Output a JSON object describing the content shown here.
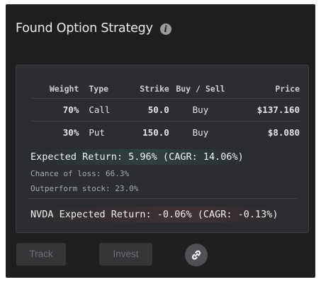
{
  "header": {
    "title": "Found Option Strategy",
    "info_icon": "info-icon"
  },
  "table": {
    "columns": [
      "Weight",
      "Type",
      "Strike",
      "Buy / Sell",
      "Price"
    ],
    "rows": [
      {
        "weight": "70%",
        "type": "Call",
        "strike": "50.0",
        "action": "Buy",
        "price": "$137.160"
      },
      {
        "weight": "30%",
        "type": "Put",
        "strike": "150.0",
        "action": "Buy",
        "price": "$8.080"
      }
    ]
  },
  "stats": {
    "expected_return": "Expected Return: 5.96% (CAGR: 14.06%)",
    "chance_of_loss": "Chance of loss: 66.3%",
    "outperform": "Outperform stock: 23.0%",
    "nvda_expected_return": "NVDA Expected Return: -0.06% (CAGR: -0.13%)"
  },
  "actions": {
    "track_label": "Track",
    "invest_label": "Invest",
    "link_icon": "link-icon"
  },
  "colors": {
    "call": "#4fa27a",
    "put": "#cf5b52",
    "panel_bg": "#1f1f1f",
    "card_bg": "#2b2d30"
  }
}
